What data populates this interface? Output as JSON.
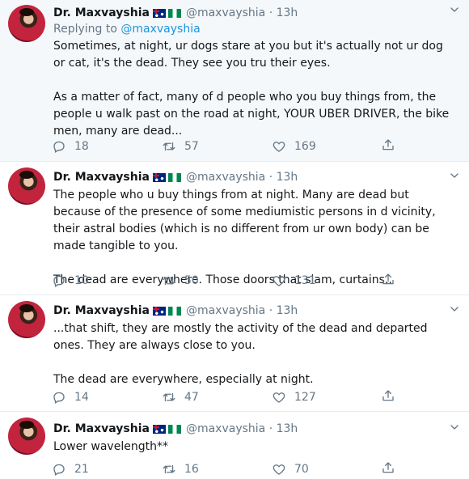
{
  "tweets": [
    {
      "name": "Dr. Maxvayshia",
      "handle": "@maxvayshia",
      "sep": "·",
      "time": "13h",
      "reply_prefix": "Replying to",
      "reply_to": "@maxvayshia",
      "p1": "Sometimes, at night, ur dogs stare at you but it's actually not ur dog or cat, it's the dead. They see you tru their eyes.",
      "p2": "As a matter of fact, many of d people who you buy things from, the people u walk past on the road at night, YOUR UBER DRIVER, the bike men, many are dead...",
      "replies": "18",
      "retweets": "57",
      "likes": "169"
    },
    {
      "name": "Dr. Maxvayshia",
      "handle": "@maxvayshia",
      "sep": "·",
      "time": "13h",
      "p1": "The people who u buy things from at night. Many are dead but because of the presence of some mediumistic persons in d vicinity, their astral bodies (which is no different from ur own body) can be made tangible to you.",
      "p2": "The dead are everywhere. Those doors that slam, curtains..",
      "replies": "10",
      "retweets": "50",
      "likes": "131"
    },
    {
      "name": "Dr. Maxvayshia",
      "handle": "@maxvayshia",
      "sep": "·",
      "time": "13h",
      "p1": "...that shift, they are mostly the activity of the dead and departed ones. They are always close to you.",
      "p2": "The dead are everywhere, especially at night.",
      "replies": "14",
      "retweets": "47",
      "likes": "127"
    },
    {
      "name": "Dr. Maxvayshia",
      "handle": "@maxvayshia",
      "sep": "·",
      "time": "13h",
      "p1": "Lower wavelength**",
      "replies": "21",
      "retweets": "16",
      "likes": "70"
    }
  ],
  "icons": {
    "more": "chevron-down-icon",
    "reply": "reply-icon",
    "retweet": "retweet-icon",
    "like": "heart-icon",
    "share": "share-icon"
  },
  "colors": {
    "text": "#14171a",
    "muted": "#657786",
    "link": "#1b95e0",
    "highlight_bg": "#f5f8fa"
  }
}
